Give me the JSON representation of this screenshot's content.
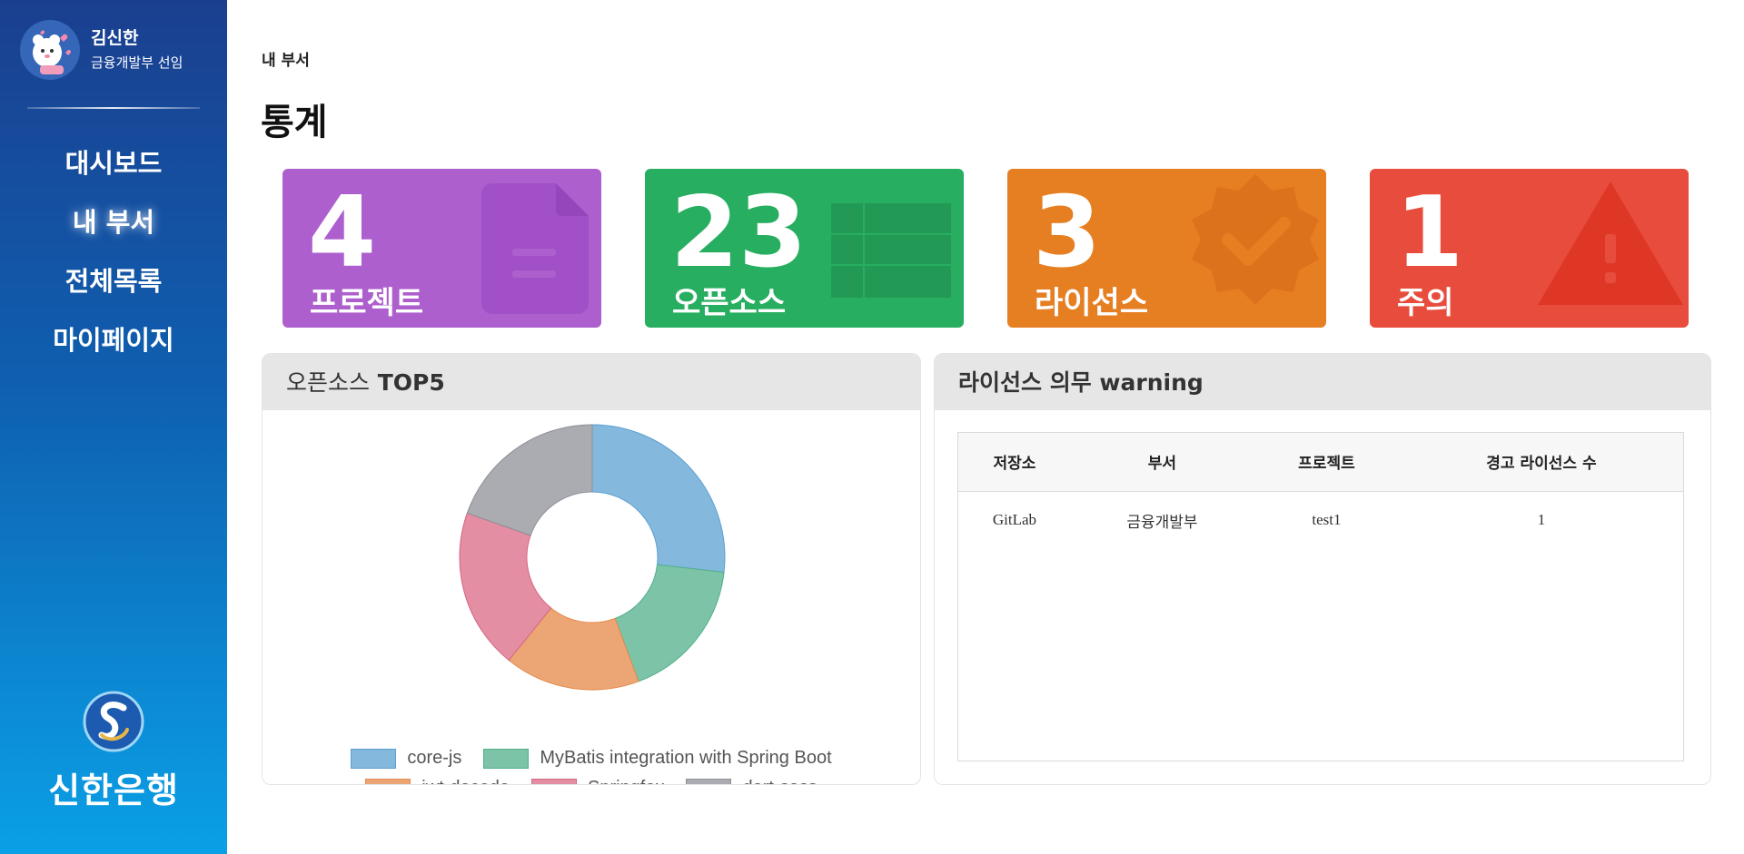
{
  "profile": {
    "name": "김신한",
    "dept": "금융개발부 선임"
  },
  "nav": {
    "items": [
      {
        "label": "대시보드"
      },
      {
        "label": "내 부서"
      },
      {
        "label": "전체목록"
      },
      {
        "label": "마이페이지"
      }
    ]
  },
  "logo": {
    "text": "신한은행"
  },
  "breadcrumb": "내 부서",
  "page_title": "통계",
  "stats": [
    {
      "value": "4",
      "label": "프로젝트",
      "color": "#ad5fcd",
      "icon": "document-icon"
    },
    {
      "value": "23",
      "label": "오픈소스",
      "color": "#27ae60",
      "icon": "table-icon"
    },
    {
      "value": "3",
      "label": "라이선스",
      "color": "#e67e22",
      "icon": "badge-check-icon"
    },
    {
      "value": "1",
      "label": "주의",
      "color": "#e74c3c",
      "icon": "warning-icon"
    }
  ],
  "top5_panel": {
    "title_prefix": "오픈소스",
    "title_suffix": "TOP5"
  },
  "warning_panel": {
    "title": "라이선스 의무 warning"
  },
  "chart_data": {
    "type": "pie",
    "donut": true,
    "categories": [
      "core-js",
      "MyBatis integration with Spring Boot",
      "jwt-decode",
      "Springfox",
      "dart-sass"
    ],
    "values": [
      26,
      17,
      16,
      19,
      19
    ],
    "colors": [
      "#85b8dd",
      "#7cc3a8",
      "#eca675",
      "#e38ea3",
      "#aaacb1"
    ],
    "border_colors": [
      "#5a9fd0",
      "#4fb08a",
      "#e6894a",
      "#d66681",
      "#8d8f96"
    ],
    "legend": "bottom"
  },
  "table": {
    "headers": [
      "저장소",
      "부서",
      "프로젝트",
      "경고 라이선스 수"
    ],
    "rows": [
      [
        "GitLab",
        "금융개발부",
        "test1",
        "1"
      ]
    ]
  }
}
